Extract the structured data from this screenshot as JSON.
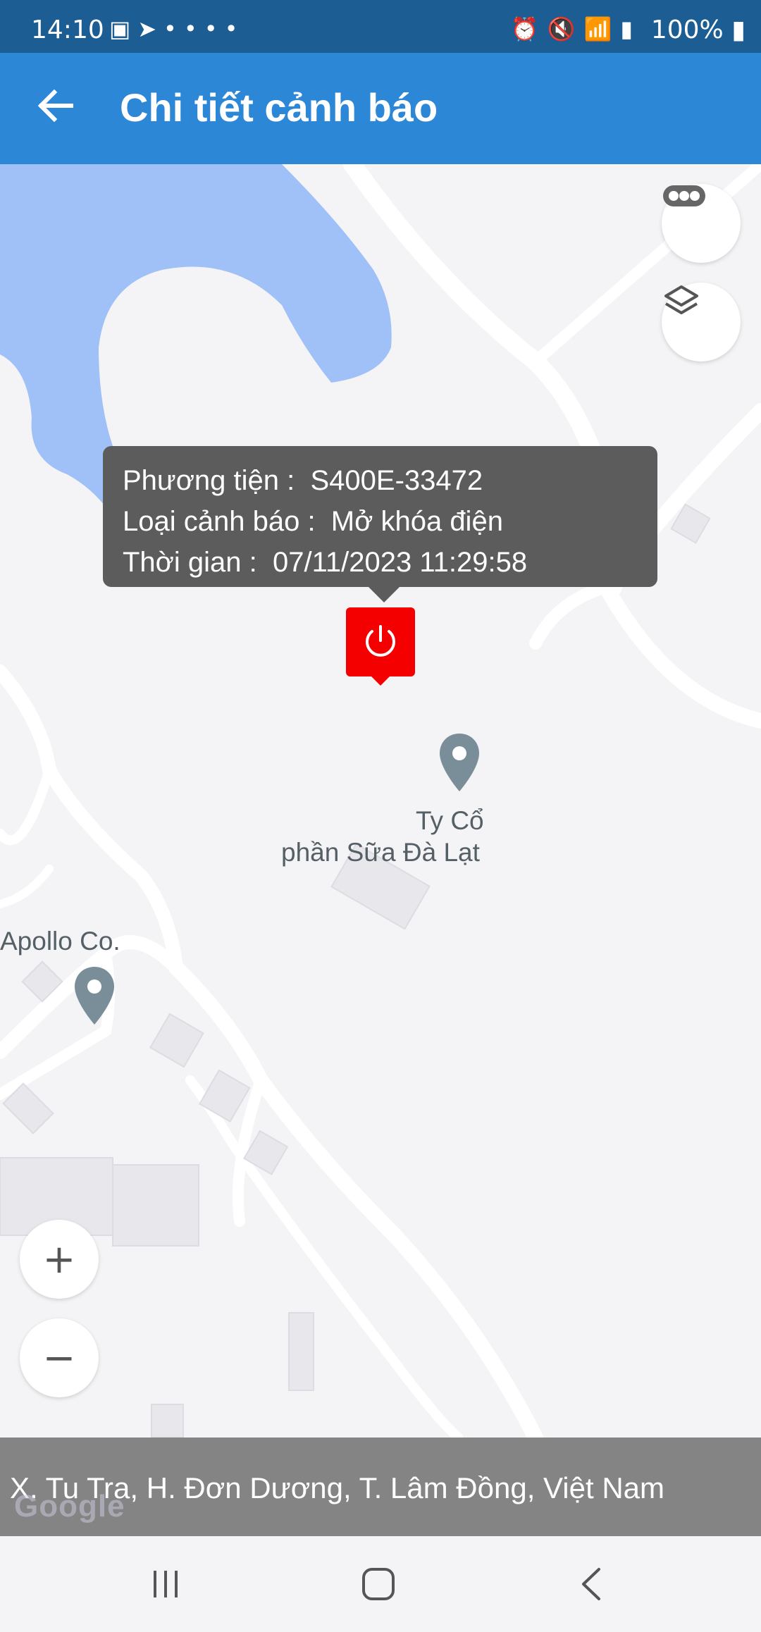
{
  "status_bar": {
    "time": "14:10",
    "left_icons": [
      "image-icon",
      "telegram-icon",
      "more-dots-icon",
      "dot-icon"
    ],
    "right_icons": [
      "alarm-icon",
      "mute-icon",
      "wifi-icon",
      "signal-icon"
    ],
    "battery": "100%"
  },
  "app_bar": {
    "title": "Chi tiết cảnh báo",
    "back_icon": "arrow-left-icon",
    "color": "#2d87d7"
  },
  "map": {
    "places": [
      {
        "name": "Ty Cổ"
      },
      {
        "name": "phần Sữa Đà Lạt"
      },
      {
        "name": "Apollo Co."
      }
    ],
    "controls": {
      "more_icon": "more-horizontal-icon",
      "layers_icon": "layers-icon",
      "zoom_in": "+",
      "zoom_out": "−"
    },
    "water_color": "#a0c0f8"
  },
  "alert_popup": {
    "rows": [
      {
        "label": "Phương tiện :",
        "value": "S400E-33472"
      },
      {
        "label": "Loại cảnh báo :",
        "value": "Mở khóa điện"
      },
      {
        "label": "Thời gian :",
        "value": "07/11/2023 11:29:58"
      }
    ],
    "marker_icon": "power-icon",
    "marker_color": "#f50000"
  },
  "address": "X. Tu Tra, H. Đơn Dương, T. Lâm Đồng, Việt Nam",
  "watermark": "Google",
  "nav_bar": {
    "buttons": [
      "recent-apps-icon",
      "home-icon",
      "back-icon"
    ]
  }
}
